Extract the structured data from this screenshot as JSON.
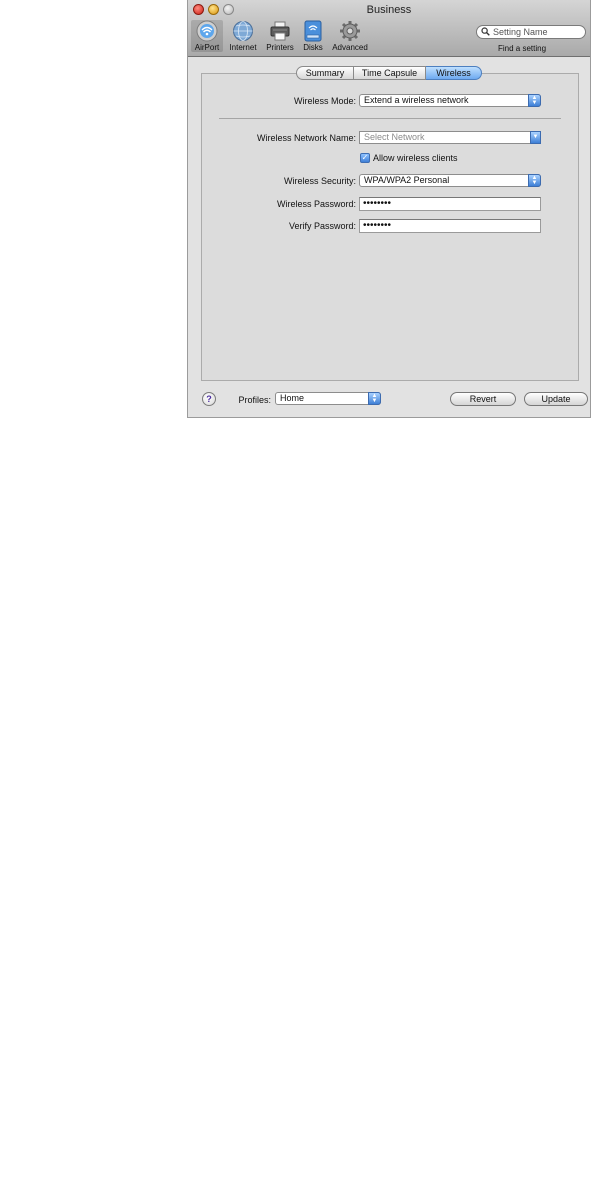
{
  "window": {
    "title": "Business"
  },
  "toolbar": {
    "items": [
      {
        "label": "AirPort",
        "icon": "airport-icon",
        "selected": true
      },
      {
        "label": "Internet",
        "icon": "globe-icon",
        "selected": false
      },
      {
        "label": "Printers",
        "icon": "printer-icon",
        "selected": false
      },
      {
        "label": "Disks",
        "icon": "disk-icon",
        "selected": false
      },
      {
        "label": "Advanced",
        "icon": "gear-icon",
        "selected": false
      }
    ],
    "search": {
      "placeholder": "Setting Name",
      "caption": "Find a setting",
      "icon": "search-icon"
    }
  },
  "tabs": [
    {
      "label": "Summary",
      "active": false
    },
    {
      "label": "Time Capsule",
      "active": false
    },
    {
      "label": "Wireless",
      "active": true
    }
  ],
  "form": {
    "wireless_mode": {
      "label": "Wireless Mode:",
      "value": "Extend a wireless network"
    },
    "network_name": {
      "label": "Wireless Network Name:",
      "placeholder": "Select Network"
    },
    "allow_clients": {
      "label": "Allow wireless clients",
      "checked": true
    },
    "security": {
      "label": "Wireless Security:",
      "value": "WPA/WPA2 Personal"
    },
    "password": {
      "label": "Wireless Password:",
      "value": "••••••••"
    },
    "verify": {
      "label": "Verify Password:",
      "value": "••••••••"
    }
  },
  "footer": {
    "help": "?",
    "profiles_label": "Profiles:",
    "profiles_value": "Home",
    "revert": "Revert",
    "update": "Update"
  },
  "colors": {
    "accent": "#3d7fd6",
    "close": "#cc1f12",
    "minimize": "#d9940e"
  }
}
